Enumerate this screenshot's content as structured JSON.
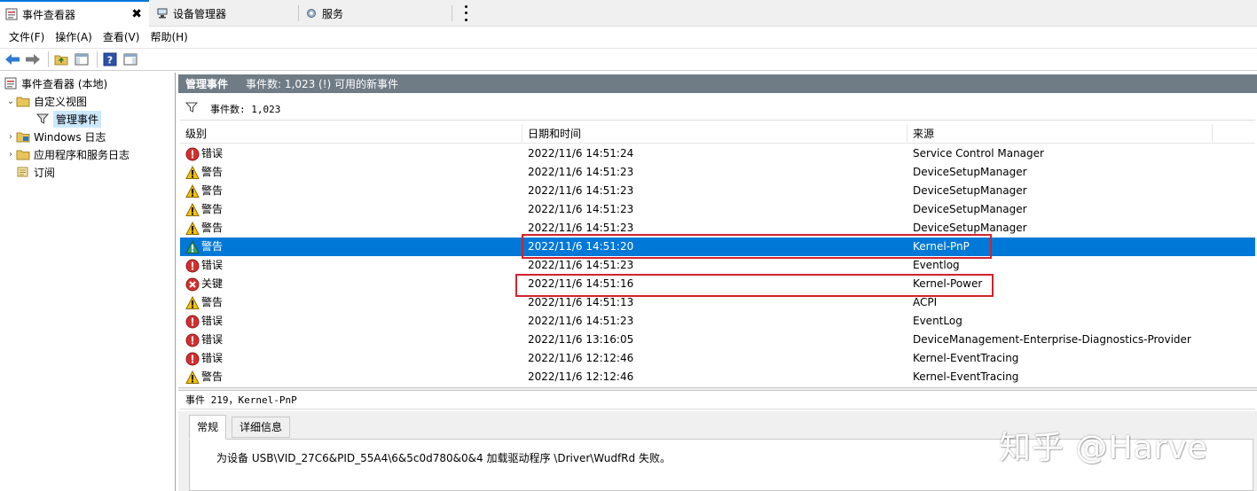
{
  "tabs": [
    {
      "label": "事件查看器",
      "icon": "event-viewer-icon"
    },
    {
      "label": "设备管理器",
      "icon": "device-manager-icon"
    },
    {
      "label": "服务",
      "icon": "services-gear-icon"
    }
  ],
  "tab_close": "✖",
  "menu": [
    "文件(F)",
    "操作(A)",
    "查看(V)",
    "帮助(H)"
  ],
  "tree": {
    "root": "事件查看器 (本地)",
    "custom_views": "自定义视图",
    "admin_events": "管理事件",
    "windows_logs": "Windows 日志",
    "app_service_logs": "应用程序和服务日志",
    "subscriptions": "订阅"
  },
  "header": {
    "title": "管理事件",
    "count": "事件数: 1,023 (!) 可用的新事件"
  },
  "filter": {
    "label": "事件数: 1,023"
  },
  "columns": {
    "level": "级别",
    "datetime": "日期和时间",
    "source": "来源"
  },
  "events": [
    {
      "level": "错误",
      "type": "error",
      "datetime": "2022/11/6 14:51:24",
      "source": "Service Control Manager"
    },
    {
      "level": "警告",
      "type": "warning",
      "datetime": "2022/11/6 14:51:23",
      "source": "DeviceSetupManager"
    },
    {
      "level": "警告",
      "type": "warning",
      "datetime": "2022/11/6 14:51:23",
      "source": "DeviceSetupManager"
    },
    {
      "level": "警告",
      "type": "warning",
      "datetime": "2022/11/6 14:51:23",
      "source": "DeviceSetupManager"
    },
    {
      "level": "警告",
      "type": "warning",
      "datetime": "2022/11/6 14:51:23",
      "source": "DeviceSetupManager"
    },
    {
      "level": "警告",
      "type": "warning",
      "datetime": "2022/11/6 14:51:20",
      "source": "Kernel-PnP",
      "selected": true
    },
    {
      "level": "错误",
      "type": "error",
      "datetime": "2022/11/6 14:51:23",
      "source": "Eventlog"
    },
    {
      "level": "关键",
      "type": "critical",
      "datetime": "2022/11/6 14:51:16",
      "source": "Kernel-Power"
    },
    {
      "level": "警告",
      "type": "warning",
      "datetime": "2022/11/6 14:51:13",
      "source": "ACPI"
    },
    {
      "level": "错误",
      "type": "error",
      "datetime": "2022/11/6 14:51:23",
      "source": "EventLog"
    },
    {
      "level": "错误",
      "type": "error",
      "datetime": "2022/11/6 13:16:05",
      "source": "DeviceManagement-Enterprise-Diagnostics-Provider"
    },
    {
      "level": "错误",
      "type": "error",
      "datetime": "2022/11/6 12:12:46",
      "source": "Kernel-EventTracing"
    },
    {
      "level": "警告",
      "type": "warning",
      "datetime": "2022/11/6 12:12:46",
      "source": "Kernel-EventTracing"
    }
  ],
  "detail": {
    "header": "事件 219，Kernel-PnP",
    "tab_general": "常规",
    "tab_details": "详细信息",
    "message": "为设备 USB\\VID_27C6&PID_55A4\\6&5c0d780&0&4 加载驱动程序 \\Driver\\WudfRd 失败。"
  },
  "watermark": "知乎 @Harve",
  "colors": {
    "accent": "#0078d7",
    "highlight_box": "#d2232a",
    "header_bar": "#6f7b85",
    "error": "#d32f2f",
    "warning": "#f4c20d",
    "warning_selected": "#3a9e6b"
  }
}
